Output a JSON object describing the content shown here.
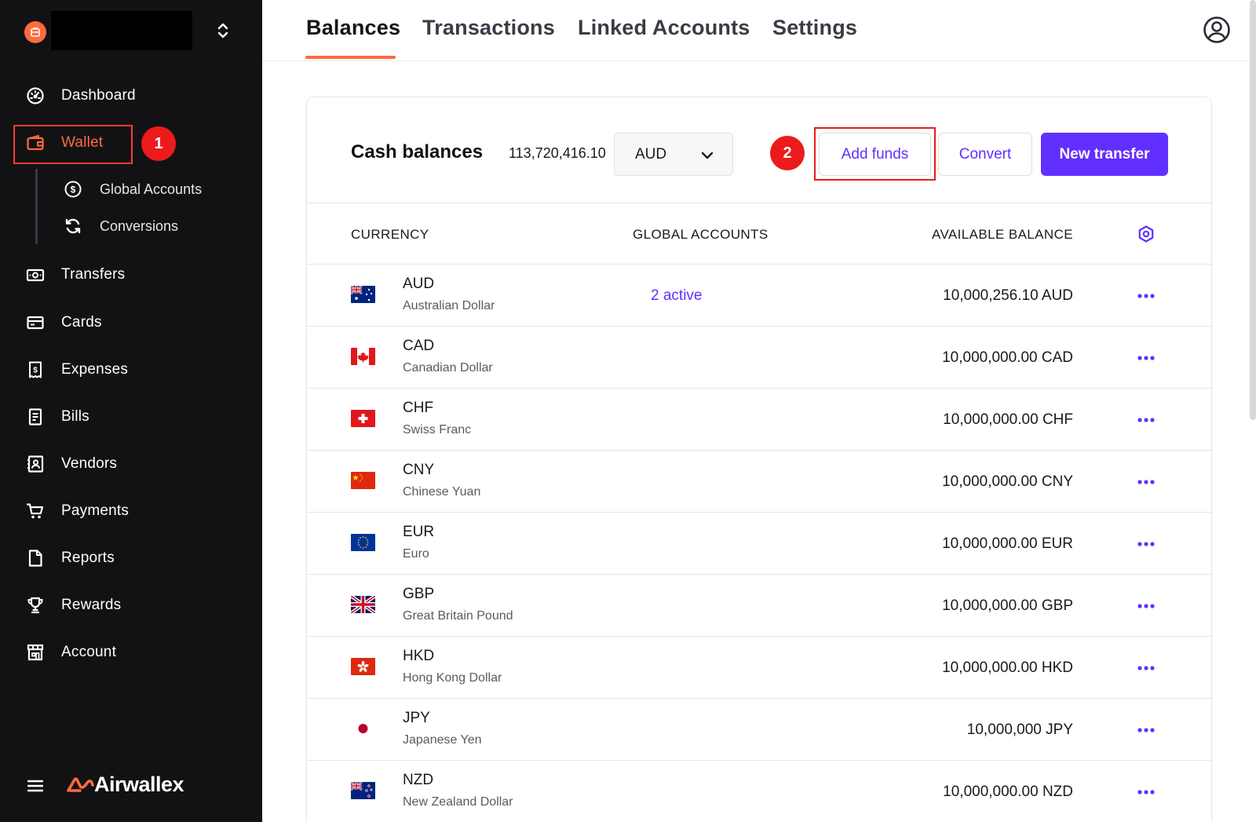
{
  "sidebar": {
    "org_name": "",
    "items": [
      {
        "label": "Dashboard",
        "icon": "dashboard-icon"
      },
      {
        "label": "Wallet",
        "icon": "wallet-icon"
      },
      {
        "label": "Transfers",
        "icon": "transfers-icon"
      },
      {
        "label": "Cards",
        "icon": "card-icon"
      },
      {
        "label": "Expenses",
        "icon": "expenses-icon"
      },
      {
        "label": "Bills",
        "icon": "bills-icon"
      },
      {
        "label": "Vendors",
        "icon": "vendors-icon"
      },
      {
        "label": "Payments",
        "icon": "cart-icon"
      },
      {
        "label": "Reports",
        "icon": "document-icon"
      },
      {
        "label": "Rewards",
        "icon": "trophy-icon"
      },
      {
        "label": "Account",
        "icon": "store-icon"
      }
    ],
    "wallet_sub": [
      {
        "label": "Global Accounts",
        "icon": "dollar-circle-icon"
      },
      {
        "label": "Conversions",
        "icon": "refresh-icon"
      }
    ],
    "brand": "Airwallex"
  },
  "annotations": {
    "step1": "1",
    "step2": "2"
  },
  "tabs": [
    {
      "label": "Balances",
      "active": true
    },
    {
      "label": "Transactions",
      "active": false
    },
    {
      "label": "Linked Accounts",
      "active": false
    },
    {
      "label": "Settings",
      "active": false
    }
  ],
  "balances": {
    "title": "Cash balances",
    "total": "113,720,416.10",
    "currency_select": "AUD",
    "buttons": {
      "add_funds": "Add funds",
      "convert": "Convert",
      "new_transfer": "New transfer"
    },
    "columns": {
      "currency": "CURRENCY",
      "global_accounts": "GLOBAL ACCOUNTS",
      "available_balance": "AVAILABLE BALANCE"
    },
    "rows": [
      {
        "code": "AUD",
        "name": "Australian Dollar",
        "global_accounts": "2 active",
        "balance": "10,000,256.10 AUD"
      },
      {
        "code": "CAD",
        "name": "Canadian Dollar",
        "global_accounts": "",
        "balance": "10,000,000.00 CAD"
      },
      {
        "code": "CHF",
        "name": "Swiss Franc",
        "global_accounts": "",
        "balance": "10,000,000.00 CHF"
      },
      {
        "code": "CNY",
        "name": "Chinese Yuan",
        "global_accounts": "",
        "balance": "10,000,000.00 CNY"
      },
      {
        "code": "EUR",
        "name": "Euro",
        "global_accounts": "",
        "balance": "10,000,000.00 EUR"
      },
      {
        "code": "GBP",
        "name": "Great Britain Pound",
        "global_accounts": "",
        "balance": "10,000,000.00 GBP"
      },
      {
        "code": "HKD",
        "name": "Hong Kong Dollar",
        "global_accounts": "",
        "balance": "10,000,000.00 HKD"
      },
      {
        "code": "JPY",
        "name": "Japanese Yen",
        "global_accounts": "",
        "balance": "10,000,000 JPY"
      },
      {
        "code": "NZD",
        "name": "New Zealand Dollar",
        "global_accounts": "",
        "balance": "10,000,000.00 NZD"
      }
    ]
  },
  "colors": {
    "accent": "#612fff",
    "brand": "#ff6a3d",
    "annotation": "#ec1b1b",
    "sidebar_bg": "#121214"
  }
}
